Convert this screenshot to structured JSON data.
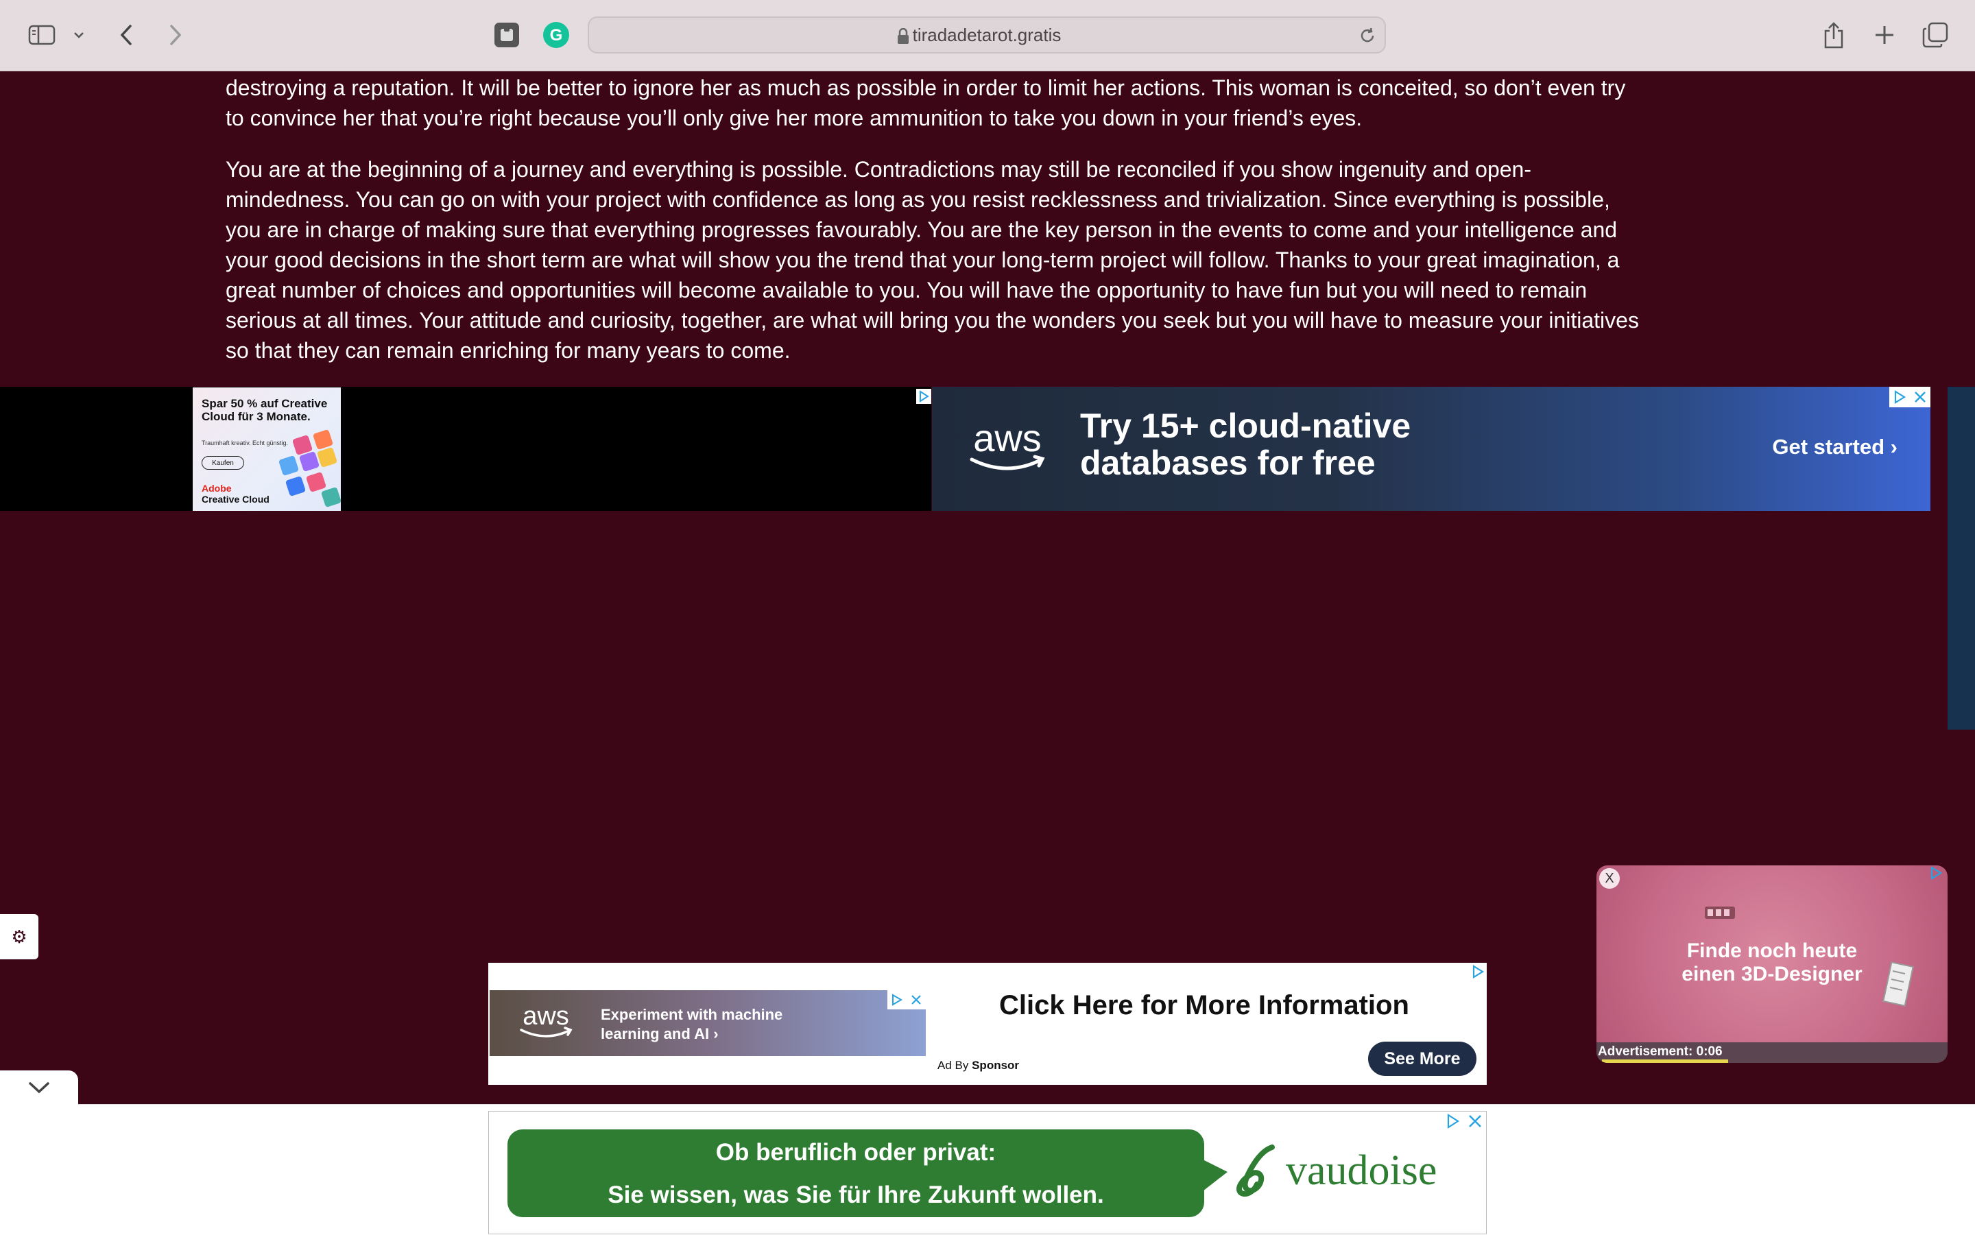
{
  "browser": {
    "url": "tiradadetarot.gratis"
  },
  "article": {
    "paragraph_1_line_1": "destroying a reputation. It will be better to ignore her as much as possible in order to limit her actions. This woman is conceited, so don’t even try",
    "paragraph_1_line_2": "to convince her that you’re right because you’ll only give her more ammunition to take you down in your friend’s eyes.",
    "paragraph_2": [
      "You are at the beginning of a journey and everything is possible. Contradictions may still be reconciled if you show ingenuity and open-",
      "mindedness. You can go on with your project with confidence as long as you resist recklessness and trivialization. Since everything is possible,",
      "you are in charge of making sure that everything progresses favourably. You are the key person in the events to come and your intelligence and",
      "your good decisions in the short term are what will show you the trend that your long-term project will follow. Thanks to your great imagination, a",
      "great number of choices and opportunities will become available to you. You will have the opportunity to have fun but you will need to remain",
      "serious at all times. Your attitude and curiosity, together, are what will bring you the wonders you seek but you will have to measure your initiatives",
      "so that they can remain enriching for many years to come."
    ]
  },
  "adobe_ad": {
    "headline": "Spar 50 % auf Creative Cloud für 3 Monate.",
    "subline": "Traumhaft kreativ. Echt günstig.",
    "button": "Kaufen",
    "brand_1": "Adobe",
    "brand_2": "Creative Cloud"
  },
  "aws_banner": {
    "logo": "aws",
    "headline_1": "Try 15+ cloud-native",
    "headline_2": "databases for free",
    "cta": "Get started ›"
  },
  "video_ad": {
    "close": "X",
    "title_1": "Finde noch heute",
    "title_2": "einen 3D-Designer",
    "footer": "Advertisement: 0:06",
    "progress": 0.36
  },
  "mid_ad": {
    "aws_logo": "aws",
    "aws_text_1": "Experiment with machine",
    "aws_text_2": "learning and AI ›",
    "headline": "Click Here for More Information",
    "ad_by": "Ad By",
    "sponsor": "Sponsor",
    "button": "See More"
  },
  "vaudoise_ad": {
    "line_1": "Ob beruflich oder privat:",
    "line_2": "Sie wissen, was Sie für Ihre Zukunft wollen.",
    "logo_text": "vaudoise"
  },
  "colors": {
    "page_bg": "#3d0616",
    "vaudoise_green": "#2f7d32",
    "aws_dark": "#1f2b3c"
  }
}
